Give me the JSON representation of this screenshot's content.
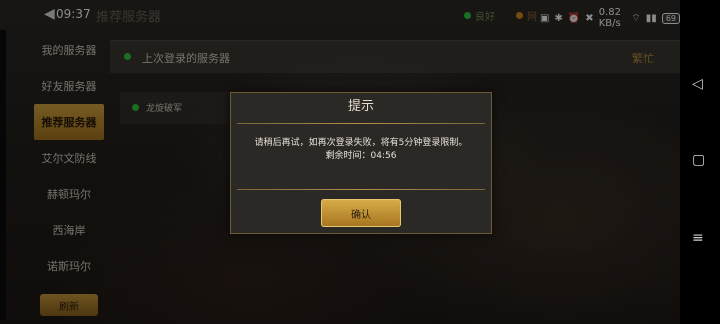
{
  "status_bar": {
    "back_icon": "back-arrow-icon",
    "time": "09:37",
    "title": "推荐服务器",
    "network_label": "良好",
    "network_color": "#2ecc40",
    "ping_label": "网",
    "ping_color": "#d28a1a",
    "signal_text": "0.82 KB/s",
    "battery": "69"
  },
  "sidebar": {
    "items": [
      {
        "label": "我的服务器"
      },
      {
        "label": "好友服务器"
      },
      {
        "label": "推荐服务器"
      },
      {
        "label": "艾尔文防线"
      },
      {
        "label": "赫顿玛尔"
      },
      {
        "label": "西海岸"
      },
      {
        "label": "诺斯玛尔"
      }
    ],
    "active_index": 2,
    "refresh_label": "刷新"
  },
  "content": {
    "last_server_label": "上次登录的服务器",
    "last_server_tag": "繁忙",
    "server_card_label": "龙旋破军"
  },
  "modal": {
    "title": "提示",
    "message": "请稍后再试，如再次登录失败，将有5分钟登录限制。",
    "timer_label": "剩余时间：",
    "timer_value": "04:56",
    "confirm_label": "确认"
  },
  "colors": {
    "accent_gold": "#c99a3a",
    "online_green": "#2ecc40"
  }
}
